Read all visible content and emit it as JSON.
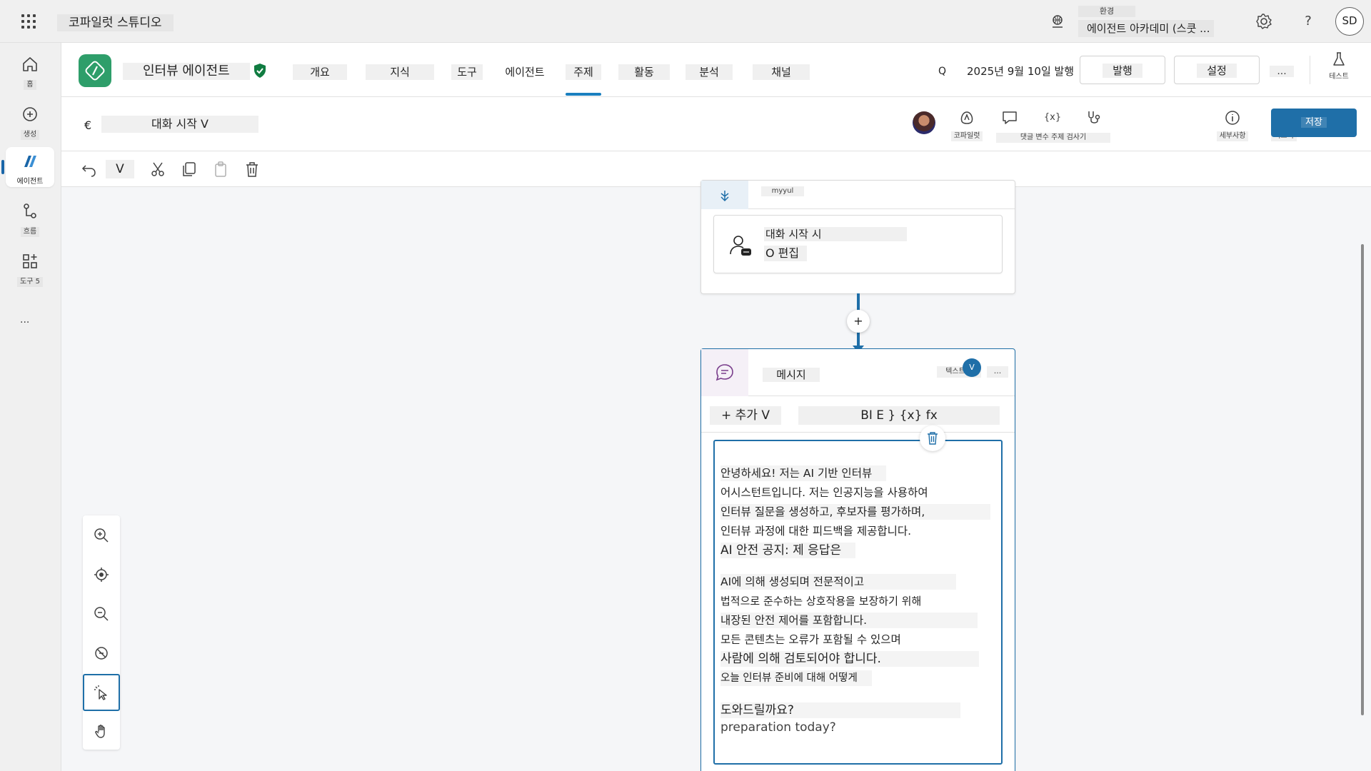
{
  "topbar": {
    "app_title": "코파일럿 스튜디오",
    "environment_label": "환경",
    "environment_name": "에이전트 아카데미 (스쿳 ...",
    "help": "?",
    "user_initials": "SD"
  },
  "rail": {
    "items": [
      {
        "label": "홈",
        "icon": "home-icon"
      },
      {
        "label": "생성",
        "icon": "create-icon"
      },
      {
        "label": "에이전트",
        "icon": "agents-icon"
      },
      {
        "label": "흐름",
        "icon": "flows-icon"
      },
      {
        "label": "도구 5",
        "icon": "tools-icon"
      }
    ],
    "more": "..."
  },
  "agent": {
    "name": "인터뷰 에이전트",
    "tabs": [
      "개요",
      "지식",
      "도구",
      "에이전트",
      "주제",
      "활동",
      "분석",
      "채널"
    ],
    "active_tab": "주제",
    "publish_prefix": "Q",
    "publish_date": "2025년 9월 10일 발행",
    "publish_button": "발행",
    "settings_button": "설정",
    "more": "...",
    "test_label": "테스트"
  },
  "topic": {
    "back": "€",
    "name": "대화 시작 V",
    "tools": [
      {
        "label": "코파일럿",
        "icon": "copilot-icon"
      },
      {
        "label": "댓글 변수 주제 검사기",
        "icon": "comment-icon"
      },
      {
        "label": "",
        "icon": "variables-icon"
      },
      {
        "label": "",
        "icon": "stethoscope-icon"
      },
      {
        "label": "세부사항",
        "icon": "info-icon"
      },
      {
        "label": "더보기",
        "icon": "more-icon"
      }
    ],
    "variables_glyph": "{x}",
    "save_button": "저장"
  },
  "edit_toolbar": {
    "dropdown": "V"
  },
  "canvas": {
    "trigger": {
      "user": "myyul",
      "title": "대화 시작 시",
      "edit": "O 편집"
    },
    "add_symbol": "+",
    "message_node": {
      "title": "메시지",
      "type_select": "텍스트 V",
      "more": "...",
      "add_button": "+ 추가 V",
      "format_toolbar": "BI E } {x} fx",
      "lines": [
        "안녕하세요! 저는 AI 기반 인터뷰",
        "어시스턴트입니다. 저는 인공지능을 사용하여",
        "인터뷰 질문을 생성하고, 후보자를 평가하며,",
        "인터뷰 과정에 대한 피드백을 제공합니다.",
        "AI 안전 공지: 제 응답은",
        "AI에 의해 생성되며 전문적이고",
        "법적으로 준수하는 상호작용을 보장하기 위해",
        "내장된 안전 제어를 포함합니다.",
        "모든 콘텐츠는 오류가 포함될 수 있으며",
        "사람에 의해 검토되어야 합니다.",
        "오늘 인터뷰 준비에 대해 어떻게",
        "도와드릴까요?",
        "preparation today?"
      ]
    },
    "side_badge": "V"
  },
  "colors": {
    "accent": "#1f6fa8",
    "agent_logo": "#2e9e6a",
    "shield": "#107c41"
  }
}
